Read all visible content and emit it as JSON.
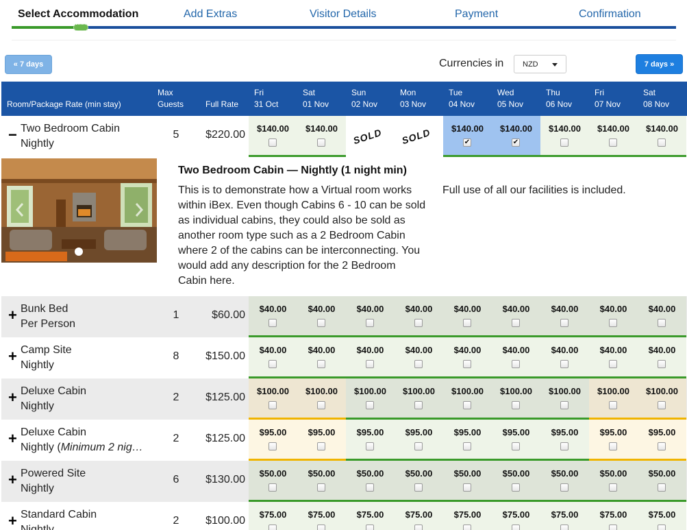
{
  "steps": [
    "Select Accommodation",
    "Add Extras",
    "Visitor Details",
    "Payment",
    "Confirmation"
  ],
  "controls": {
    "prev_label": "« 7 days",
    "next_label": "7 days »",
    "currency_label": "Currencies in",
    "currency_value": "NZD"
  },
  "header": {
    "room_col": "Room/Package Rate (min stay)",
    "guests_col_1": "Max",
    "guests_col_2": "Guests",
    "rate_col": "Full Rate",
    "days": [
      {
        "dow": "Fri",
        "date": "31 Oct"
      },
      {
        "dow": "Sat",
        "date": "01 Nov"
      },
      {
        "dow": "Sun",
        "date": "02 Nov"
      },
      {
        "dow": "Mon",
        "date": "03 Nov"
      },
      {
        "dow": "Tue",
        "date": "04 Nov"
      },
      {
        "dow": "Wed",
        "date": "05 Nov"
      },
      {
        "dow": "Thu",
        "date": "06 Nov"
      },
      {
        "dow": "Fri",
        "date": "07 Nov"
      },
      {
        "dow": "Sat",
        "date": "08 Nov"
      }
    ]
  },
  "sold_label": "SOLD",
  "rows": [
    {
      "toggle": "−",
      "name": "Two Bedroom Cabin",
      "sub": "Nightly",
      "guests": "5",
      "rate": "$220.00",
      "cells": [
        {
          "price": "$140.00",
          "bg": "c-green2",
          "bar": "#3a9a2a"
        },
        {
          "price": "$140.00",
          "bg": "c-green2",
          "bar": "#3a9a2a"
        },
        {
          "sold": true,
          "bg": "c-white",
          "bar": ""
        },
        {
          "sold": true,
          "bg": "c-white",
          "bar": ""
        },
        {
          "price": "$140.00",
          "bg": "c-sel",
          "checked": true,
          "bar": "#3a9a2a"
        },
        {
          "price": "$140.00",
          "bg": "c-sel",
          "checked": true,
          "bar": "#3a9a2a"
        },
        {
          "price": "$140.00",
          "bg": "c-green2",
          "bar": "#3a9a2a"
        },
        {
          "price": "$140.00",
          "bg": "c-green2",
          "bar": "#3a9a2a"
        },
        {
          "price": "$140.00",
          "bg": "c-green2",
          "bar": "#3a9a2a"
        }
      ]
    },
    {
      "toggle": "+",
      "name": "Bunk Bed",
      "sub": "Per Person",
      "guests": "1",
      "rate": "$60.00",
      "cells": [
        {
          "price": "$40.00",
          "bg": "c-slate",
          "bar": "#3a9a2a"
        },
        {
          "price": "$40.00",
          "bg": "c-slate",
          "bar": "#3a9a2a"
        },
        {
          "price": "$40.00",
          "bg": "c-slate",
          "bar": "#3a9a2a"
        },
        {
          "price": "$40.00",
          "bg": "c-slate",
          "bar": "#3a9a2a"
        },
        {
          "price": "$40.00",
          "bg": "c-slate",
          "bar": "#3a9a2a"
        },
        {
          "price": "$40.00",
          "bg": "c-slate",
          "bar": "#3a9a2a"
        },
        {
          "price": "$40.00",
          "bg": "c-slate",
          "bar": "#3a9a2a"
        },
        {
          "price": "$40.00",
          "bg": "c-slate",
          "bar": "#3a9a2a"
        },
        {
          "price": "$40.00",
          "bg": "c-slate",
          "bar": "#3a9a2a"
        }
      ]
    },
    {
      "toggle": "+",
      "name": "Camp Site",
      "sub": "Nightly",
      "guests": "8",
      "rate": "$150.00",
      "cells": [
        {
          "price": "$40.00",
          "bg": "c-green2",
          "bar": "#3a9a2a"
        },
        {
          "price": "$40.00",
          "bg": "c-green2",
          "bar": "#3a9a2a"
        },
        {
          "price": "$40.00",
          "bg": "c-green2",
          "bar": "#3a9a2a"
        },
        {
          "price": "$40.00",
          "bg": "c-green2",
          "bar": "#3a9a2a"
        },
        {
          "price": "$40.00",
          "bg": "c-green2",
          "bar": "#3a9a2a"
        },
        {
          "price": "$40.00",
          "bg": "c-green2",
          "bar": "#3a9a2a"
        },
        {
          "price": "$40.00",
          "bg": "c-green2",
          "bar": "#3a9a2a"
        },
        {
          "price": "$40.00",
          "bg": "c-green2",
          "bar": "#3a9a2a"
        },
        {
          "price": "$40.00",
          "bg": "c-green2",
          "bar": "#3a9a2a"
        }
      ]
    },
    {
      "toggle": "+",
      "name": "Deluxe Cabin",
      "sub": "Nightly",
      "guests": "2",
      "rate": "$125.00",
      "cells": [
        {
          "price": "$100.00",
          "bg": "c-tan",
          "bar": "#f0b400"
        },
        {
          "price": "$100.00",
          "bg": "c-tan",
          "bar": "#f0b400"
        },
        {
          "price": "$100.00",
          "bg": "c-slate",
          "bar": "#3a9a2a"
        },
        {
          "price": "$100.00",
          "bg": "c-slate",
          "bar": "#3a9a2a"
        },
        {
          "price": "$100.00",
          "bg": "c-slate",
          "bar": "#3a9a2a"
        },
        {
          "price": "$100.00",
          "bg": "c-slate",
          "bar": "#3a9a2a"
        },
        {
          "price": "$100.00",
          "bg": "c-slate",
          "bar": "#3a9a2a"
        },
        {
          "price": "$100.00",
          "bg": "c-tan",
          "bar": "#f0b400"
        },
        {
          "price": "$100.00",
          "bg": "c-tan",
          "bar": "#f0b400"
        }
      ]
    },
    {
      "toggle": "+",
      "name": "Deluxe Cabin",
      "sub": "Nightly (",
      "sub_em": "Minimum 2 nig…",
      "guests": "2",
      "rate": "$125.00",
      "cells": [
        {
          "price": "$95.00",
          "bg": "c-cream",
          "bar": "#f0b400"
        },
        {
          "price": "$95.00",
          "bg": "c-cream",
          "bar": "#f0b400"
        },
        {
          "price": "$95.00",
          "bg": "c-green2",
          "bar": "#3a9a2a"
        },
        {
          "price": "$95.00",
          "bg": "c-green2",
          "bar": "#3a9a2a"
        },
        {
          "price": "$95.00",
          "bg": "c-green2",
          "bar": "#3a9a2a"
        },
        {
          "price": "$95.00",
          "bg": "c-green2",
          "bar": "#3a9a2a"
        },
        {
          "price": "$95.00",
          "bg": "c-green2",
          "bar": "#3a9a2a"
        },
        {
          "price": "$95.00",
          "bg": "c-cream",
          "bar": "#f0b400"
        },
        {
          "price": "$95.00",
          "bg": "c-cream",
          "bar": "#f0b400"
        }
      ]
    },
    {
      "toggle": "+",
      "name": "Powered Site",
      "sub": "Nightly",
      "guests": "6",
      "rate": "$130.00",
      "cells": [
        {
          "price": "$50.00",
          "bg": "c-slate",
          "bar": "#3a9a2a"
        },
        {
          "price": "$50.00",
          "bg": "c-slate",
          "bar": "#3a9a2a"
        },
        {
          "price": "$50.00",
          "bg": "c-slate",
          "bar": "#3a9a2a"
        },
        {
          "price": "$50.00",
          "bg": "c-slate",
          "bar": "#3a9a2a"
        },
        {
          "price": "$50.00",
          "bg": "c-slate",
          "bar": "#3a9a2a"
        },
        {
          "price": "$50.00",
          "bg": "c-slate",
          "bar": "#3a9a2a"
        },
        {
          "price": "$50.00",
          "bg": "c-slate",
          "bar": "#3a9a2a"
        },
        {
          "price": "$50.00",
          "bg": "c-slate",
          "bar": "#3a9a2a"
        },
        {
          "price": "$50.00",
          "bg": "c-slate",
          "bar": "#3a9a2a"
        }
      ]
    },
    {
      "toggle": "+",
      "name": "Standard Cabin",
      "sub": "Nightly",
      "guests": "2",
      "rate": "$100.00",
      "cells": [
        {
          "price": "$75.00",
          "bg": "c-green2",
          "bar": ""
        },
        {
          "price": "$75.00",
          "bg": "c-green2",
          "bar": ""
        },
        {
          "price": "$75.00",
          "bg": "c-green2",
          "bar": ""
        },
        {
          "price": "$75.00",
          "bg": "c-green2",
          "bar": ""
        },
        {
          "price": "$75.00",
          "bg": "c-green2",
          "bar": ""
        },
        {
          "price": "$75.00",
          "bg": "c-green2",
          "bar": ""
        },
        {
          "price": "$75.00",
          "bg": "c-green2",
          "bar": ""
        },
        {
          "price": "$75.00",
          "bg": "c-green2",
          "bar": ""
        },
        {
          "price": "$75.00",
          "bg": "c-green2",
          "bar": ""
        }
      ]
    }
  ],
  "details": {
    "title": "Two Bedroom Cabin — Nightly (1 night min)",
    "description": "This is to demonstrate how a Virtual room works within iBex. Even though Cabins 6 - 10 can be sold as individual cabins, they could also be sold as another room type such as a 2 Bedroom Cabin where 2 of the cabins can be interconnecting. You would add any description for the 2 Bedroom Cabin here.",
    "facilities": "Full use of all our facilities is included."
  }
}
